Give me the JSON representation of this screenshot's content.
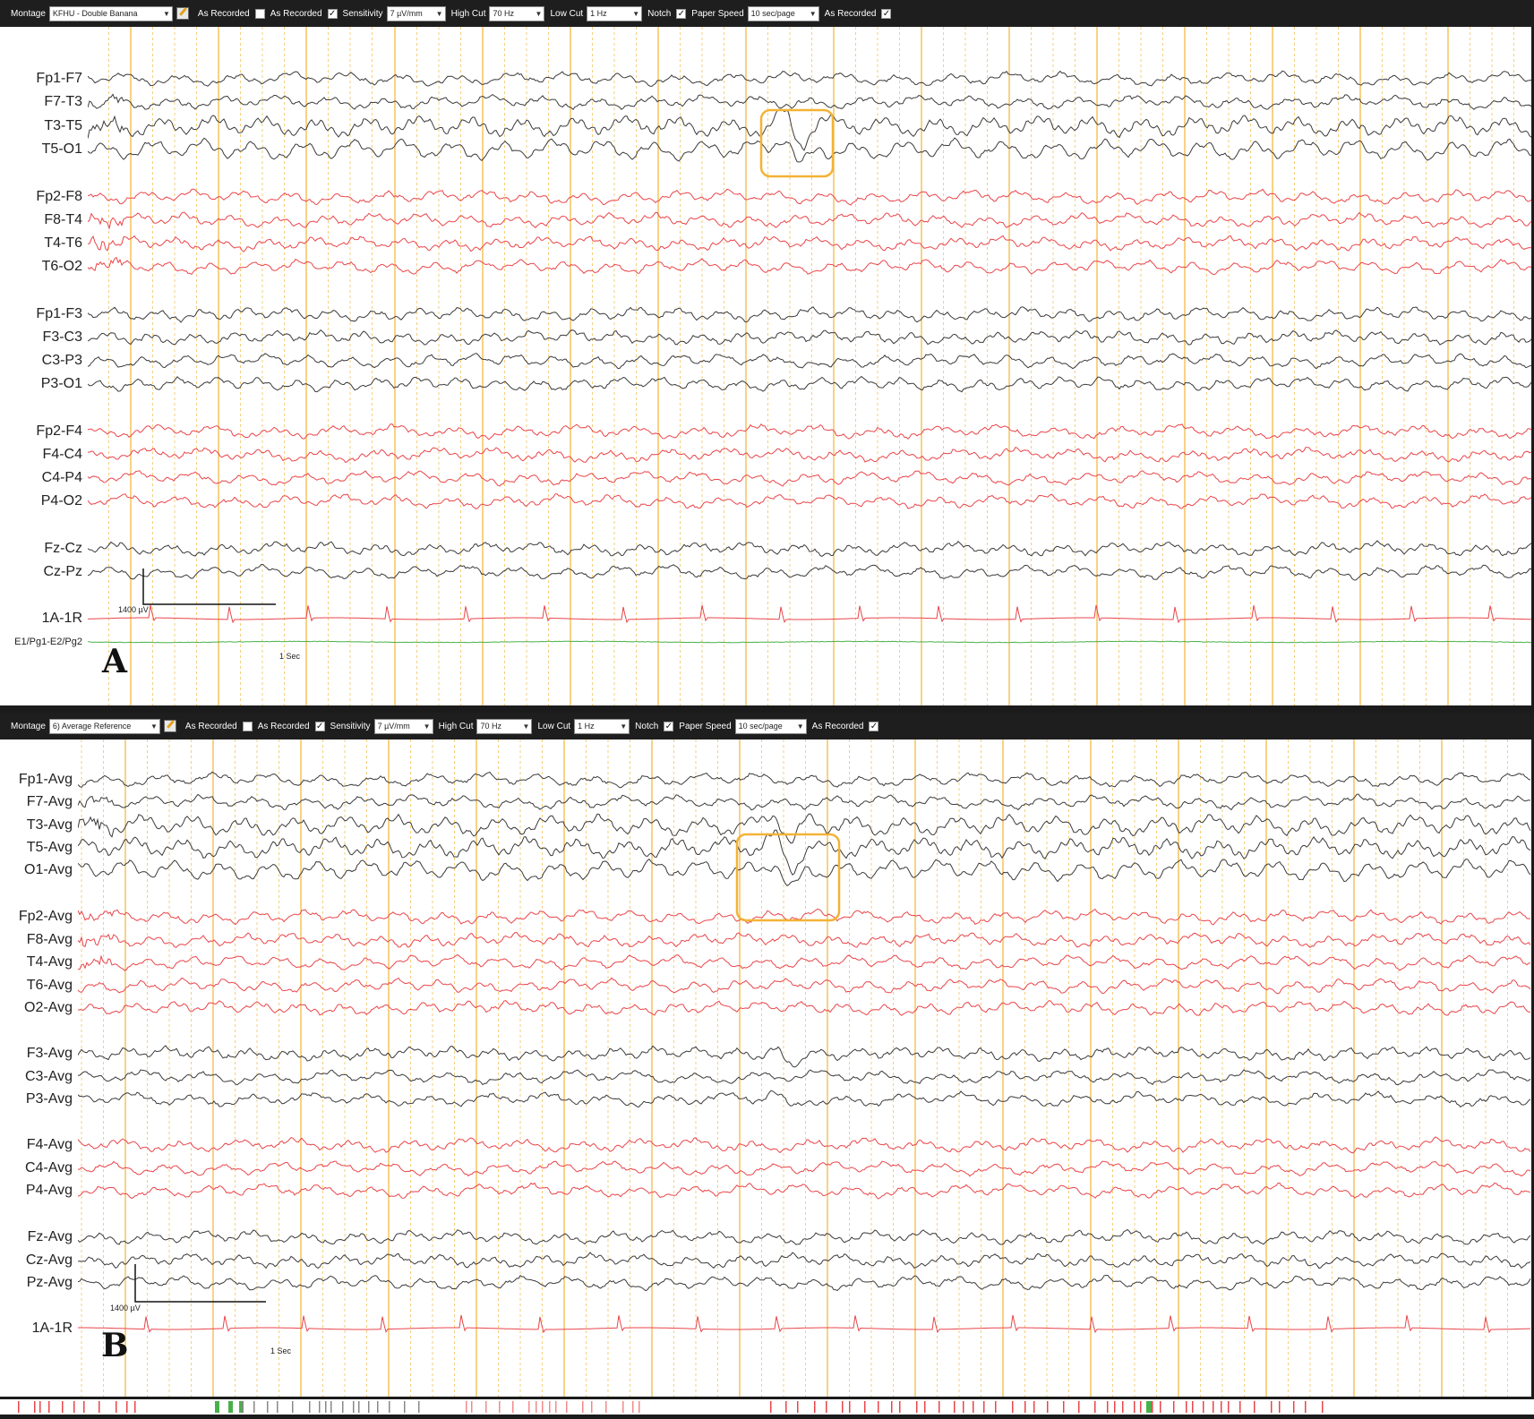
{
  "panels": [
    {
      "id": "A",
      "letter": "A",
      "toolbar": {
        "montage_label": "Montage",
        "montage_value": "KFHU - Double Banana",
        "as_recorded_1": "As Recorded",
        "as_recorded_2": "As Recorded",
        "sensitivity_label": "Sensitivity",
        "sensitivity_value": "7 µV/mm",
        "high_cut_label": "High Cut",
        "high_cut_value": "70 Hz",
        "low_cut_label": "Low Cut",
        "low_cut_value": "1 Hz",
        "notch_label": "Notch",
        "paper_speed_label": "Paper Speed",
        "paper_speed_value": "10 sec/page",
        "as_recorded_3": "As Recorded"
      },
      "scale": {
        "amplitude": "1400 µV",
        "time": "1 Sec"
      },
      "channels": [
        {
          "name": "Fp1-F7",
          "color": "#3a3a3a"
        },
        {
          "name": "F7-T3",
          "color": "#3a3a3a"
        },
        {
          "name": "T3-T5",
          "color": "#3a3a3a"
        },
        {
          "name": "T5-O1",
          "color": "#3a3a3a"
        },
        {
          "name": "Fp2-F8",
          "color": "#e8454a"
        },
        {
          "name": "F8-T4",
          "color": "#e8454a"
        },
        {
          "name": "T4-T6",
          "color": "#e8454a"
        },
        {
          "name": "T6-O2",
          "color": "#e8454a"
        },
        {
          "name": "Fp1-F3",
          "color": "#3a3a3a"
        },
        {
          "name": "F3-C3",
          "color": "#3a3a3a"
        },
        {
          "name": "C3-P3",
          "color": "#3a3a3a"
        },
        {
          "name": "P3-O1",
          "color": "#3a3a3a"
        },
        {
          "name": "Fp2-F4",
          "color": "#e8454a"
        },
        {
          "name": "F4-C4",
          "color": "#e8454a"
        },
        {
          "name": "C4-P4",
          "color": "#e8454a"
        },
        {
          "name": "P4-O2",
          "color": "#e8454a"
        },
        {
          "name": "Fz-Cz",
          "color": "#3a3a3a"
        },
        {
          "name": "Cz-Pz",
          "color": "#3a3a3a"
        },
        {
          "name": "1A-1R",
          "color": "#e8454a",
          "kind": "ecg"
        },
        {
          "name": "E1/Pg1-E2/Pg2",
          "color": "#49b049",
          "kind": "flat"
        }
      ]
    },
    {
      "id": "B",
      "letter": "B",
      "toolbar": {
        "montage_label": "Montage",
        "montage_value": "6) Average Reference",
        "as_recorded_1": "As Recorded",
        "as_recorded_2": "As Recorded",
        "sensitivity_label": "Sensitivity",
        "sensitivity_value": "7 µV/mm",
        "high_cut_label": "High Cut",
        "high_cut_value": "70 Hz",
        "low_cut_label": "Low Cut",
        "low_cut_value": "1 Hz",
        "notch_label": "Notch",
        "paper_speed_label": "Paper Speed",
        "paper_speed_value": "10 sec/page",
        "as_recorded_3": "As Recorded"
      },
      "scale": {
        "amplitude": "1400 µV",
        "time": "1 Sec"
      },
      "channels": [
        {
          "name": "Fp1-Avg",
          "color": "#3a3a3a"
        },
        {
          "name": "F7-Avg",
          "color": "#3a3a3a"
        },
        {
          "name": "T3-Avg",
          "color": "#3a3a3a"
        },
        {
          "name": "T5-Avg",
          "color": "#3a3a3a"
        },
        {
          "name": "O1-Avg",
          "color": "#3a3a3a"
        },
        {
          "name": "Fp2-Avg",
          "color": "#e8454a"
        },
        {
          "name": "F8-Avg",
          "color": "#e8454a"
        },
        {
          "name": "T4-Avg",
          "color": "#e8454a"
        },
        {
          "name": "T6-Avg",
          "color": "#e8454a"
        },
        {
          "name": "O2-Avg",
          "color": "#e8454a"
        },
        {
          "name": "F3-Avg",
          "color": "#3a3a3a"
        },
        {
          "name": "C3-Avg",
          "color": "#3a3a3a"
        },
        {
          "name": "P3-Avg",
          "color": "#3a3a3a"
        },
        {
          "name": "F4-Avg",
          "color": "#e8454a"
        },
        {
          "name": "C4-Avg",
          "color": "#e8454a"
        },
        {
          "name": "P4-Avg",
          "color": "#e8454a"
        },
        {
          "name": "Fz-Avg",
          "color": "#3a3a3a"
        },
        {
          "name": "Cz-Avg",
          "color": "#3a3a3a"
        },
        {
          "name": "Pz-Avg",
          "color": "#3a3a3a"
        },
        {
          "name": "1A-1R",
          "color": "#e8454a",
          "kind": "ecg"
        }
      ]
    }
  ],
  "colors": {
    "grid_second": "#f2b335",
    "highlight_box": "#f2b335",
    "left_channels": "#3a3a3a",
    "right_channels": "#e8454a",
    "eog": "#49b049"
  }
}
